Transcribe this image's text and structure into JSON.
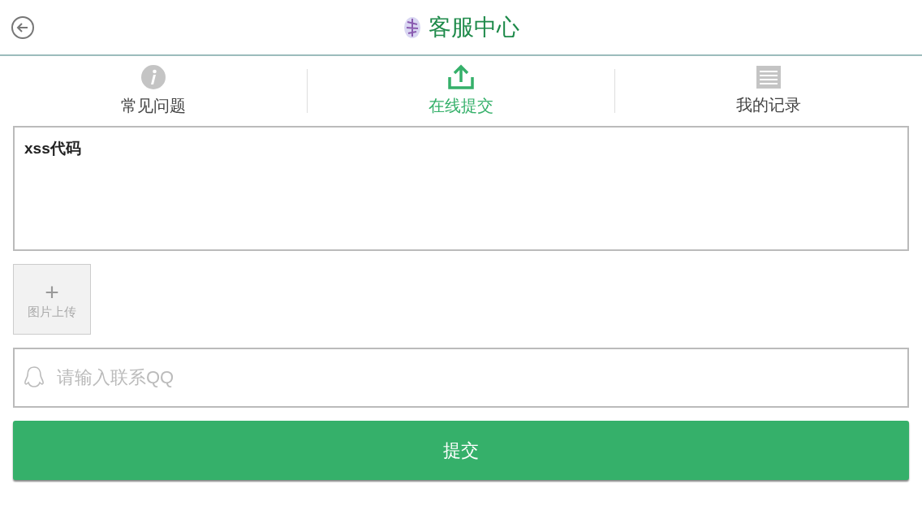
{
  "header": {
    "title": "客服中心"
  },
  "tabs": [
    {
      "label": "常见问题",
      "kind": "info",
      "selected": false
    },
    {
      "label": "在线提交",
      "kind": "upload",
      "selected": true
    },
    {
      "label": "我的记录",
      "kind": "list",
      "selected": false
    }
  ],
  "form": {
    "message": "xss代码",
    "upload_label": "图片上传",
    "upload_symbol": "+",
    "qq_placeholder": "请输入联系QQ",
    "submit": "提交"
  }
}
